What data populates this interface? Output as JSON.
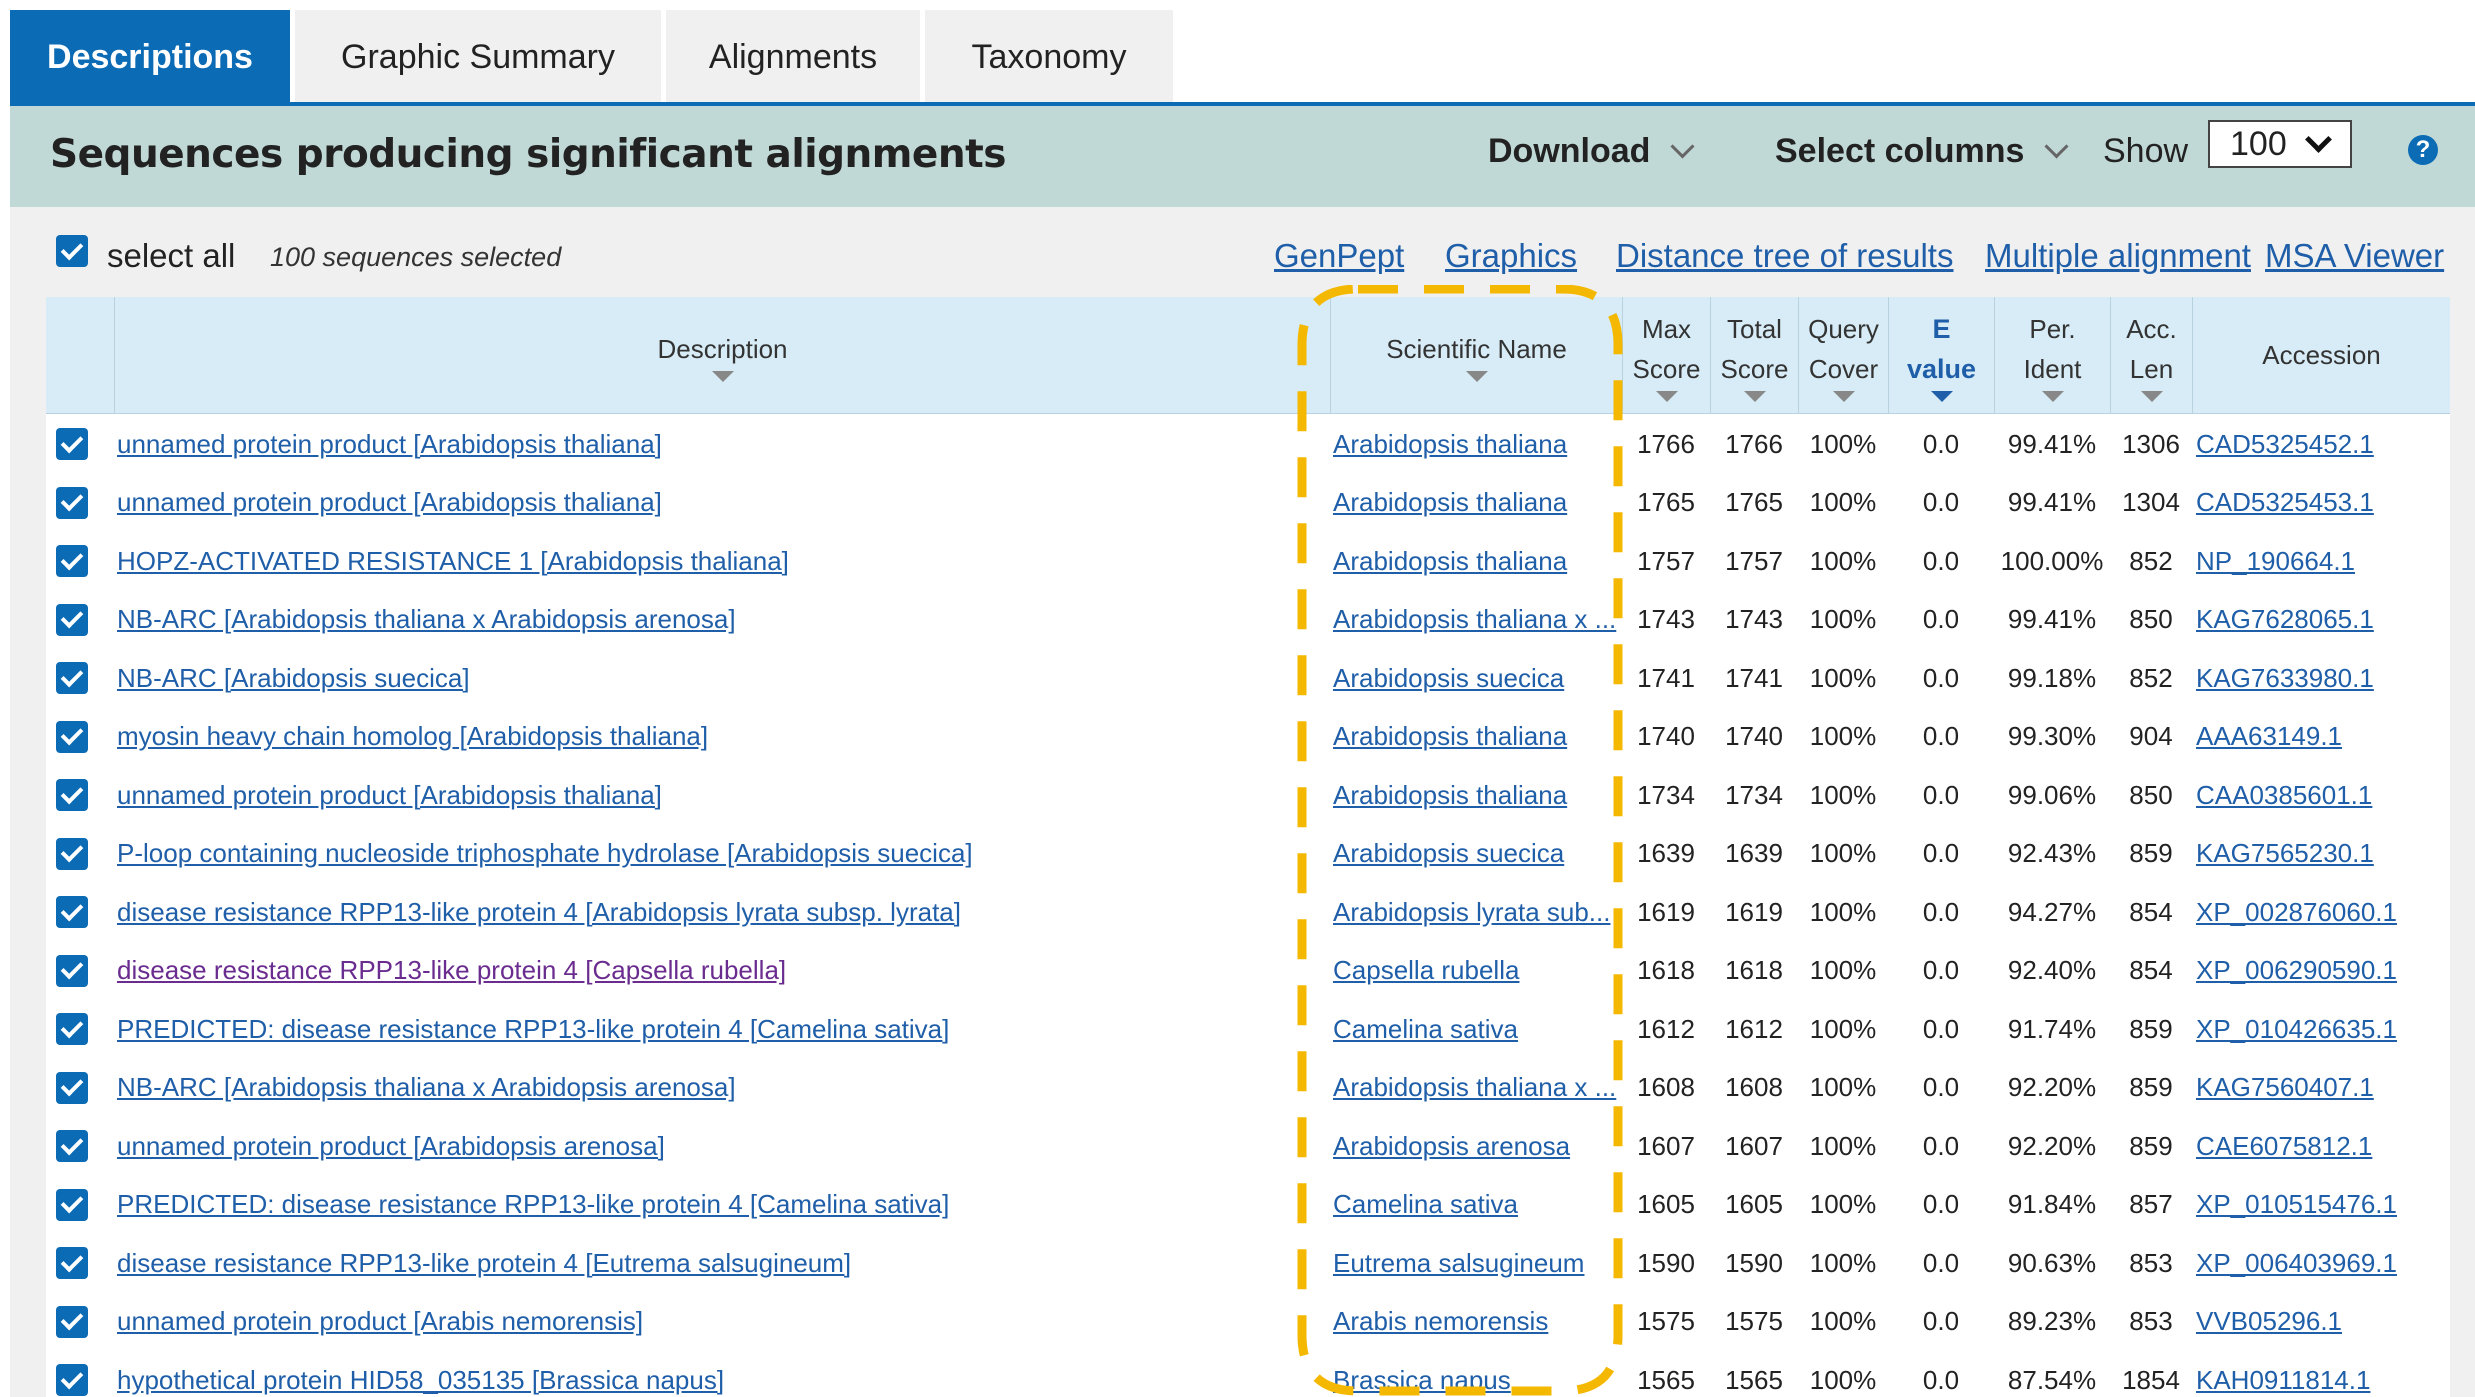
{
  "tabs": [
    {
      "label": "Descriptions",
      "active": true
    },
    {
      "label": "Graphic Summary",
      "active": false
    },
    {
      "label": "Alignments",
      "active": false
    },
    {
      "label": "Taxonomy",
      "active": false
    }
  ],
  "header": {
    "title": "Sequences producing significant alignments",
    "download_label": "Download",
    "select_columns_label": "Select columns",
    "show_label": "Show",
    "show_value": "100",
    "help_glyph": "?"
  },
  "selection": {
    "select_all_label": "select all",
    "selected_count": "100 sequences selected"
  },
  "links": {
    "genpept": "GenPept",
    "graphics": "Graphics",
    "distance_tree": "Distance tree of results",
    "multiple_alignment": "Multiple alignment",
    "msa_viewer": "MSA Viewer"
  },
  "columns": {
    "description": "Description",
    "scientific_name": "Scientific Name",
    "max_score": [
      "Max",
      "Score"
    ],
    "total_score": [
      "Total",
      "Score"
    ],
    "query_cover": [
      "Query",
      "Cover"
    ],
    "e_value": [
      "E",
      "value"
    ],
    "per_ident": [
      "Per.",
      "Ident"
    ],
    "acc_len": [
      "Acc.",
      "Len"
    ],
    "accession": "Accession"
  },
  "colors": {
    "accent": "#0b6bb5",
    "header_band": "#c0d9d6",
    "table_header": "#d7ecf6",
    "link": "#1f5ea8",
    "visited_link": "#6a2c8f",
    "highlight_dash": "#f5b800"
  },
  "rows": [
    {
      "description": "unnamed protein product [Arabidopsis thaliana]",
      "scientific_name": "Arabidopsis thaliana",
      "max_score": "1766",
      "total_score": "1766",
      "query_cover": "100%",
      "e_value": "0.0",
      "per_ident": "99.41%",
      "acc_len": "1306",
      "accession": "CAD5325452.1"
    },
    {
      "description": "unnamed protein product [Arabidopsis thaliana]",
      "scientific_name": "Arabidopsis thaliana",
      "max_score": "1765",
      "total_score": "1765",
      "query_cover": "100%",
      "e_value": "0.0",
      "per_ident": "99.41%",
      "acc_len": "1304",
      "accession": "CAD5325453.1"
    },
    {
      "description": "HOPZ-ACTIVATED RESISTANCE 1 [Arabidopsis thaliana]",
      "scientific_name": "Arabidopsis thaliana",
      "max_score": "1757",
      "total_score": "1757",
      "query_cover": "100%",
      "e_value": "0.0",
      "per_ident": "100.00%",
      "acc_len": "852",
      "accession": "NP_190664.1"
    },
    {
      "description": "NB-ARC [Arabidopsis thaliana x Arabidopsis arenosa]",
      "scientific_name": "Arabidopsis thaliana x ...",
      "max_score": "1743",
      "total_score": "1743",
      "query_cover": "100%",
      "e_value": "0.0",
      "per_ident": "99.41%",
      "acc_len": "850",
      "accession": "KAG7628065.1"
    },
    {
      "description": "NB-ARC [Arabidopsis suecica]",
      "scientific_name": "Arabidopsis suecica",
      "max_score": "1741",
      "total_score": "1741",
      "query_cover": "100%",
      "e_value": "0.0",
      "per_ident": "99.18%",
      "acc_len": "852",
      "accession": "KAG7633980.1"
    },
    {
      "description": "myosin heavy chain homolog [Arabidopsis thaliana]",
      "scientific_name": "Arabidopsis thaliana",
      "max_score": "1740",
      "total_score": "1740",
      "query_cover": "100%",
      "e_value": "0.0",
      "per_ident": "99.30%",
      "acc_len": "904",
      "accession": "AAA63149.1"
    },
    {
      "description": "unnamed protein product [Arabidopsis thaliana]",
      "scientific_name": "Arabidopsis thaliana",
      "max_score": "1734",
      "total_score": "1734",
      "query_cover": "100%",
      "e_value": "0.0",
      "per_ident": "99.06%",
      "acc_len": "850",
      "accession": "CAA0385601.1"
    },
    {
      "description": "P-loop containing nucleoside triphosphate hydrolase [Arabidopsis suecica]",
      "scientific_name": "Arabidopsis suecica",
      "max_score": "1639",
      "total_score": "1639",
      "query_cover": "100%",
      "e_value": "0.0",
      "per_ident": "92.43%",
      "acc_len": "859",
      "accession": "KAG7565230.1"
    },
    {
      "description": "disease resistance RPP13-like protein 4 [Arabidopsis lyrata subsp. lyrata]",
      "scientific_name": "Arabidopsis lyrata sub...",
      "max_score": "1619",
      "total_score": "1619",
      "query_cover": "100%",
      "e_value": "0.0",
      "per_ident": "94.27%",
      "acc_len": "854",
      "accession": "XP_002876060.1"
    },
    {
      "description": "disease resistance RPP13-like protein 4 [Capsella rubella]",
      "scientific_name": "Capsella rubella",
      "max_score": "1618",
      "total_score": "1618",
      "query_cover": "100%",
      "e_value": "0.0",
      "per_ident": "92.40%",
      "acc_len": "854",
      "accession": "XP_006290590.1",
      "visited": true
    },
    {
      "description": "PREDICTED: disease resistance RPP13-like protein 4 [Camelina sativa]",
      "scientific_name": "Camelina sativa",
      "max_score": "1612",
      "total_score": "1612",
      "query_cover": "100%",
      "e_value": "0.0",
      "per_ident": "91.74%",
      "acc_len": "859",
      "accession": "XP_010426635.1"
    },
    {
      "description": "NB-ARC [Arabidopsis thaliana x Arabidopsis arenosa]",
      "scientific_name": "Arabidopsis thaliana x ...",
      "max_score": "1608",
      "total_score": "1608",
      "query_cover": "100%",
      "e_value": "0.0",
      "per_ident": "92.20%",
      "acc_len": "859",
      "accession": "KAG7560407.1"
    },
    {
      "description": "unnamed protein product [Arabidopsis arenosa]",
      "scientific_name": "Arabidopsis arenosa",
      "max_score": "1607",
      "total_score": "1607",
      "query_cover": "100%",
      "e_value": "0.0",
      "per_ident": "92.20%",
      "acc_len": "859",
      "accession": "CAE6075812.1"
    },
    {
      "description": "PREDICTED: disease resistance RPP13-like protein 4 [Camelina sativa]",
      "scientific_name": "Camelina sativa",
      "max_score": "1605",
      "total_score": "1605",
      "query_cover": "100%",
      "e_value": "0.0",
      "per_ident": "91.84%",
      "acc_len": "857",
      "accession": "XP_010515476.1"
    },
    {
      "description": "disease resistance RPP13-like protein 4 [Eutrema salsugineum]",
      "scientific_name": "Eutrema salsugineum",
      "max_score": "1590",
      "total_score": "1590",
      "query_cover": "100%",
      "e_value": "0.0",
      "per_ident": "90.63%",
      "acc_len": "853",
      "accession": "XP_006403969.1"
    },
    {
      "description": "unnamed protein product [Arabis nemorensis]",
      "scientific_name": "Arabis nemorensis",
      "max_score": "1575",
      "total_score": "1575",
      "query_cover": "100%",
      "e_value": "0.0",
      "per_ident": "89.23%",
      "acc_len": "853",
      "accession": "VVB05296.1"
    },
    {
      "description": "hypothetical protein HID58_035135 [Brassica napus]",
      "scientific_name": "Brassica napus",
      "max_score": "1565",
      "total_score": "1565",
      "query_cover": "100%",
      "e_value": "0.0",
      "per_ident": "87.54%",
      "acc_len": "1854",
      "accession": "KAH0911814.1"
    }
  ]
}
